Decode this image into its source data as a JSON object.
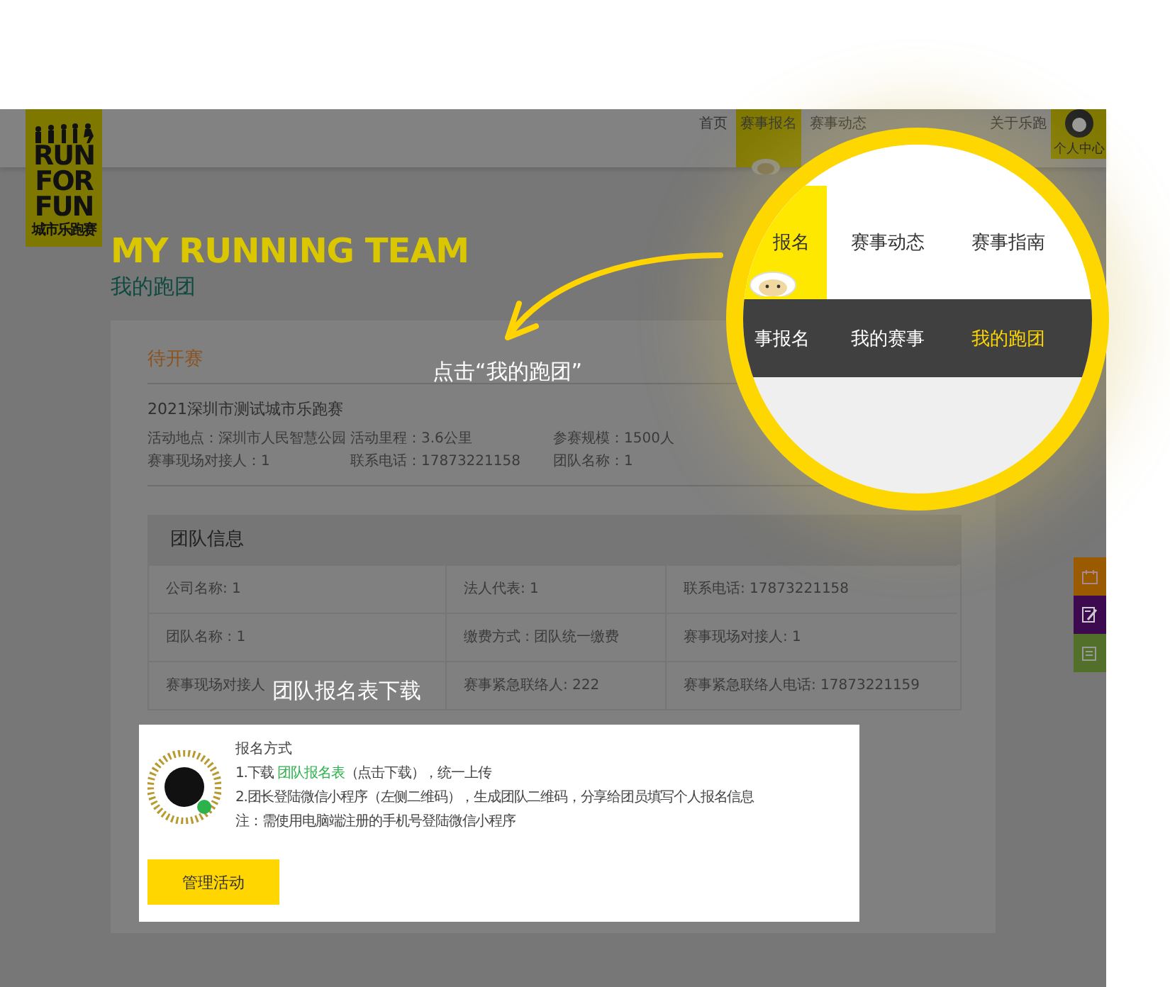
{
  "header": {
    "logo": {
      "lines": [
        "RUN",
        "FOR",
        "FUN"
      ],
      "subtitle": "城市乐跑赛"
    },
    "nav": [
      {
        "label": "首页",
        "selected": false
      },
      {
        "label": "赛事报名",
        "selected": true
      },
      {
        "label": "赛事动态",
        "selected": false
      },
      {
        "label": "关于乐跑",
        "selected": false
      }
    ],
    "user": {
      "label": "个人中心"
    }
  },
  "page": {
    "title": "MY RUNNING TEAM",
    "subtitle": "我的跑团"
  },
  "upcoming": {
    "heading": "待开赛",
    "event_name": "2021深圳市测试城市乐跑赛",
    "fields": [
      "活动地点：深圳市人民智慧公园",
      "活动里程：3.6公里",
      "参赛规模：1500人",
      "赛事现场对接人：1",
      "联系电话：17873221158",
      "团队名称：1"
    ]
  },
  "team_info": {
    "heading": "团队信息",
    "cells": [
      "公司名称: 1",
      "法人代表: 1",
      "联系电话: 17873221158",
      "团队名称 : 1",
      "缴费方式 : 团队统一缴费",
      "赛事现场对接人: 1",
      "赛事现场对接人",
      "赛事紧急联络人: 222",
      "赛事紧急联络人电话: 17873221159"
    ]
  },
  "signup": {
    "heading": "报名方式",
    "step_1": {
      "before": "1.下载 ",
      "link": "团队报名表",
      "after": "（点击下载），统一上传"
    },
    "step_2": "2.团长登陆微信小程序（左侧二维码），生成团队二维码，分享给团员填写个人报名信息",
    "note": "注：需使用电脑端注册的手机号登陆微信小程序",
    "button": "管理活动"
  },
  "side_buttons": [
    {
      "kind": "calendar",
      "color": "#9a5a00"
    },
    {
      "kind": "edit",
      "color": "#3d0a4f"
    },
    {
      "kind": "list",
      "color": "#52702a"
    }
  ],
  "magnifier": {
    "top_nav": [
      {
        "label": "报名",
        "selected": true
      },
      {
        "label": "赛事动态",
        "selected": false
      },
      {
        "label": "赛事指南",
        "selected": false
      }
    ],
    "sub_nav": [
      {
        "label": "事报名",
        "selected": false
      },
      {
        "label": "我的赛事",
        "selected": false
      },
      {
        "label": "我的跑团",
        "selected": true
      }
    ]
  },
  "callouts": [
    {
      "text": "点击“我的跑团”"
    },
    {
      "text": "团队报名表下载"
    }
  ]
}
